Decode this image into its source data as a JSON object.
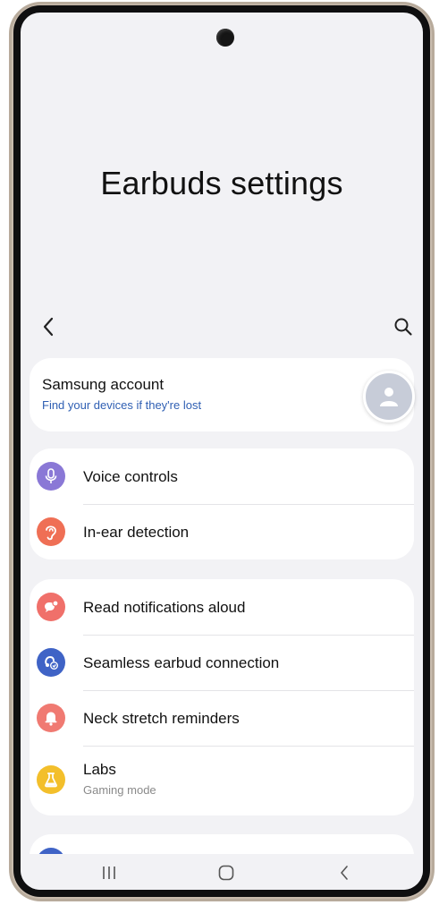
{
  "screen": {
    "title": "Earbuds settings"
  },
  "topbar": {
    "back_icon": "chevron-left-icon",
    "search_icon": "search-icon"
  },
  "account": {
    "name": "Samsung account",
    "link": "Find your devices if they're lost",
    "avatar_icon": "person-icon"
  },
  "group1": [
    {
      "label": "Voice controls",
      "icon": "microphone-icon",
      "color": "#8a78d6"
    },
    {
      "label": "In-ear detection",
      "icon": "ear-icon",
      "color": "#ef6f55"
    }
  ],
  "group2": [
    {
      "label": "Read notifications aloud",
      "icon": "notification-speech-icon",
      "color": "#f0706a"
    },
    {
      "label": "Seamless earbud connection",
      "icon": "connection-sync-icon",
      "color": "#3f63c6"
    },
    {
      "label": "Neck stretch reminders",
      "icon": "bell-icon",
      "color": "#f07a72"
    },
    {
      "label": "Labs",
      "sub": "Gaming mode",
      "icon": "flask-icon",
      "color": "#f3bf2b"
    }
  ],
  "navbar": {
    "recents_icon": "recents-icon",
    "home_icon": "home-icon",
    "back_icon": "back-icon"
  },
  "colors": {
    "background": "#f2f2f5",
    "card": "#ffffff",
    "link": "#2f5fb3",
    "partial_icon": "#3f63c6"
  }
}
